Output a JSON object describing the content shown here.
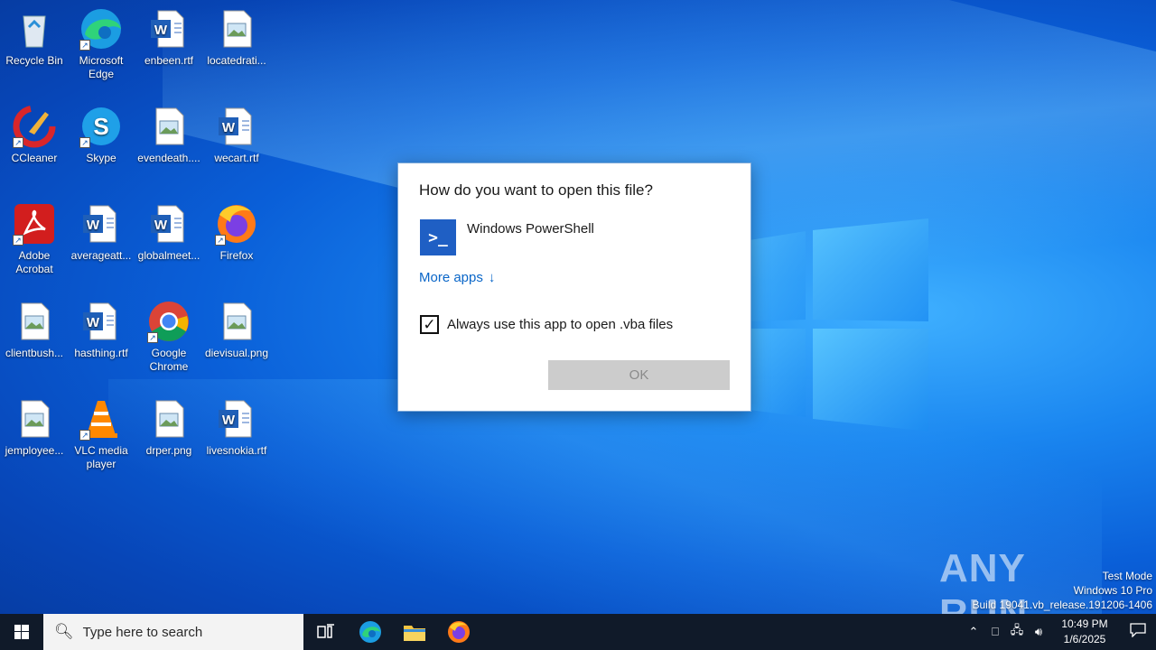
{
  "desktop_icons": [
    {
      "label": "Recycle Bin",
      "icon": "recycle-bin-icon"
    },
    {
      "label": "Microsoft Edge",
      "icon": "edge-icon"
    },
    {
      "label": "enbeen.rtf",
      "icon": "word-document-icon"
    },
    {
      "label": "locatedrati...",
      "icon": "image-file-icon"
    },
    {
      "label": "CCleaner",
      "icon": "ccleaner-icon"
    },
    {
      "label": "Skype",
      "icon": "skype-icon"
    },
    {
      "label": "evendeath....",
      "icon": "image-file-icon"
    },
    {
      "label": "wecart.rtf",
      "icon": "word-document-icon"
    },
    {
      "label": "Adobe Acrobat",
      "icon": "acrobat-icon"
    },
    {
      "label": "averageatt...",
      "icon": "word-document-icon"
    },
    {
      "label": "globalmeet...",
      "icon": "word-document-icon"
    },
    {
      "label": "Firefox",
      "icon": "firefox-icon"
    },
    {
      "label": "clientbush...",
      "icon": "image-file-icon"
    },
    {
      "label": "hasthing.rtf",
      "icon": "word-document-icon"
    },
    {
      "label": "Google Chrome",
      "icon": "chrome-icon"
    },
    {
      "label": "dievisual.png",
      "icon": "image-file-icon"
    },
    {
      "label": "jemployee...",
      "icon": "image-file-icon"
    },
    {
      "label": "VLC media player",
      "icon": "vlc-icon"
    },
    {
      "label": "drper.png",
      "icon": "image-file-icon"
    },
    {
      "label": "livesnokia.rtf",
      "icon": "word-document-icon"
    }
  ],
  "dialog": {
    "title": "How do you want to open this file?",
    "app_name": "Windows PowerShell",
    "more_apps": "More apps",
    "checkbox_label": "Always use this app to open .vba files",
    "checkbox_checked": true,
    "ok_label": "OK"
  },
  "watermark": {
    "text": "ANY RUN"
  },
  "system_info": {
    "line1": "Test Mode",
    "line2": "Windows 10 Pro",
    "line3": "Build 19041.vb_release.191206-1406"
  },
  "taskbar": {
    "search_placeholder": "Type here to search",
    "time": "10:49 PM",
    "date": "1/6/2025"
  },
  "colors": {
    "accent": "#0a66c8",
    "taskbar": "#101a29",
    "powershell": "#1f5fc4"
  }
}
